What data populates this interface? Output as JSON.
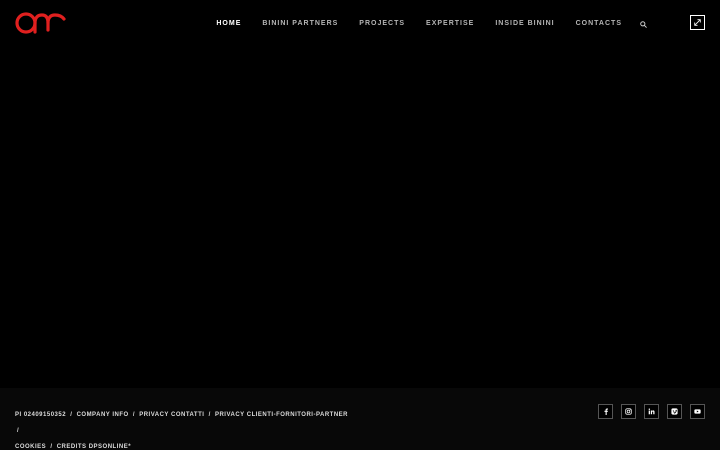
{
  "colors": {
    "background": "#000000",
    "footer_background": "#080808",
    "logo_red": "#e0201f",
    "nav_text": "#b5b5b5",
    "nav_active": "#ffffff"
  },
  "header": {
    "logo_icon": "binini-logo-icon",
    "nav": [
      {
        "label": "HOME",
        "active": true
      },
      {
        "label": "BININI PARTNERS"
      },
      {
        "label": "PROJECTS"
      },
      {
        "label": "EXPERTISE"
      },
      {
        "label": "INSIDE BININI"
      },
      {
        "label": "CONTACTS"
      }
    ],
    "search_icon": "search-icon",
    "menu_icon": "expand-icon"
  },
  "footer": {
    "links": [
      "PI 02409150352",
      "COMPANY INFO",
      "PRIVACY CONTATTI",
      "PRIVACY CLIENTI-FORNITORI-PARTNER",
      "COOKIES",
      "CREDITS DPSONLINE*"
    ],
    "separator": "/",
    "socials": [
      {
        "icon": "facebook-icon"
      },
      {
        "icon": "instagram-icon"
      },
      {
        "icon": "linkedin-icon"
      },
      {
        "icon": "vimeo-icon"
      },
      {
        "icon": "youtube-icon"
      }
    ]
  }
}
